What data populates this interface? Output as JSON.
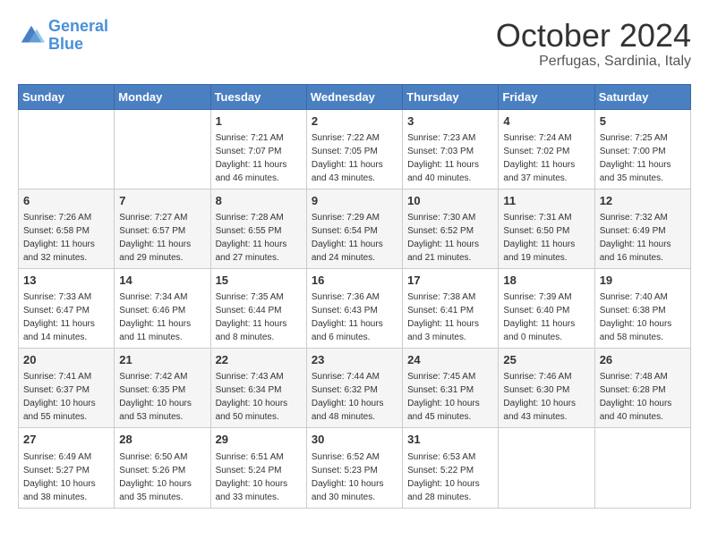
{
  "logo": {
    "line1": "General",
    "line2": "Blue"
  },
  "title": "October 2024",
  "subtitle": "Perfugas, Sardinia, Italy",
  "days_header": [
    "Sunday",
    "Monday",
    "Tuesday",
    "Wednesday",
    "Thursday",
    "Friday",
    "Saturday"
  ],
  "weeks": [
    [
      {
        "day": "",
        "info": ""
      },
      {
        "day": "",
        "info": ""
      },
      {
        "day": "1",
        "info": "Sunrise: 7:21 AM\nSunset: 7:07 PM\nDaylight: 11 hours and 46 minutes."
      },
      {
        "day": "2",
        "info": "Sunrise: 7:22 AM\nSunset: 7:05 PM\nDaylight: 11 hours and 43 minutes."
      },
      {
        "day": "3",
        "info": "Sunrise: 7:23 AM\nSunset: 7:03 PM\nDaylight: 11 hours and 40 minutes."
      },
      {
        "day": "4",
        "info": "Sunrise: 7:24 AM\nSunset: 7:02 PM\nDaylight: 11 hours and 37 minutes."
      },
      {
        "day": "5",
        "info": "Sunrise: 7:25 AM\nSunset: 7:00 PM\nDaylight: 11 hours and 35 minutes."
      }
    ],
    [
      {
        "day": "6",
        "info": "Sunrise: 7:26 AM\nSunset: 6:58 PM\nDaylight: 11 hours and 32 minutes."
      },
      {
        "day": "7",
        "info": "Sunrise: 7:27 AM\nSunset: 6:57 PM\nDaylight: 11 hours and 29 minutes."
      },
      {
        "day": "8",
        "info": "Sunrise: 7:28 AM\nSunset: 6:55 PM\nDaylight: 11 hours and 27 minutes."
      },
      {
        "day": "9",
        "info": "Sunrise: 7:29 AM\nSunset: 6:54 PM\nDaylight: 11 hours and 24 minutes."
      },
      {
        "day": "10",
        "info": "Sunrise: 7:30 AM\nSunset: 6:52 PM\nDaylight: 11 hours and 21 minutes."
      },
      {
        "day": "11",
        "info": "Sunrise: 7:31 AM\nSunset: 6:50 PM\nDaylight: 11 hours and 19 minutes."
      },
      {
        "day": "12",
        "info": "Sunrise: 7:32 AM\nSunset: 6:49 PM\nDaylight: 11 hours and 16 minutes."
      }
    ],
    [
      {
        "day": "13",
        "info": "Sunrise: 7:33 AM\nSunset: 6:47 PM\nDaylight: 11 hours and 14 minutes."
      },
      {
        "day": "14",
        "info": "Sunrise: 7:34 AM\nSunset: 6:46 PM\nDaylight: 11 hours and 11 minutes."
      },
      {
        "day": "15",
        "info": "Sunrise: 7:35 AM\nSunset: 6:44 PM\nDaylight: 11 hours and 8 minutes."
      },
      {
        "day": "16",
        "info": "Sunrise: 7:36 AM\nSunset: 6:43 PM\nDaylight: 11 hours and 6 minutes."
      },
      {
        "day": "17",
        "info": "Sunrise: 7:38 AM\nSunset: 6:41 PM\nDaylight: 11 hours and 3 minutes."
      },
      {
        "day": "18",
        "info": "Sunrise: 7:39 AM\nSunset: 6:40 PM\nDaylight: 11 hours and 0 minutes."
      },
      {
        "day": "19",
        "info": "Sunrise: 7:40 AM\nSunset: 6:38 PM\nDaylight: 10 hours and 58 minutes."
      }
    ],
    [
      {
        "day": "20",
        "info": "Sunrise: 7:41 AM\nSunset: 6:37 PM\nDaylight: 10 hours and 55 minutes."
      },
      {
        "day": "21",
        "info": "Sunrise: 7:42 AM\nSunset: 6:35 PM\nDaylight: 10 hours and 53 minutes."
      },
      {
        "day": "22",
        "info": "Sunrise: 7:43 AM\nSunset: 6:34 PM\nDaylight: 10 hours and 50 minutes."
      },
      {
        "day": "23",
        "info": "Sunrise: 7:44 AM\nSunset: 6:32 PM\nDaylight: 10 hours and 48 minutes."
      },
      {
        "day": "24",
        "info": "Sunrise: 7:45 AM\nSunset: 6:31 PM\nDaylight: 10 hours and 45 minutes."
      },
      {
        "day": "25",
        "info": "Sunrise: 7:46 AM\nSunset: 6:30 PM\nDaylight: 10 hours and 43 minutes."
      },
      {
        "day": "26",
        "info": "Sunrise: 7:48 AM\nSunset: 6:28 PM\nDaylight: 10 hours and 40 minutes."
      }
    ],
    [
      {
        "day": "27",
        "info": "Sunrise: 6:49 AM\nSunset: 5:27 PM\nDaylight: 10 hours and 38 minutes."
      },
      {
        "day": "28",
        "info": "Sunrise: 6:50 AM\nSunset: 5:26 PM\nDaylight: 10 hours and 35 minutes."
      },
      {
        "day": "29",
        "info": "Sunrise: 6:51 AM\nSunset: 5:24 PM\nDaylight: 10 hours and 33 minutes."
      },
      {
        "day": "30",
        "info": "Sunrise: 6:52 AM\nSunset: 5:23 PM\nDaylight: 10 hours and 30 minutes."
      },
      {
        "day": "31",
        "info": "Sunrise: 6:53 AM\nSunset: 5:22 PM\nDaylight: 10 hours and 28 minutes."
      },
      {
        "day": "",
        "info": ""
      },
      {
        "day": "",
        "info": ""
      }
    ]
  ]
}
